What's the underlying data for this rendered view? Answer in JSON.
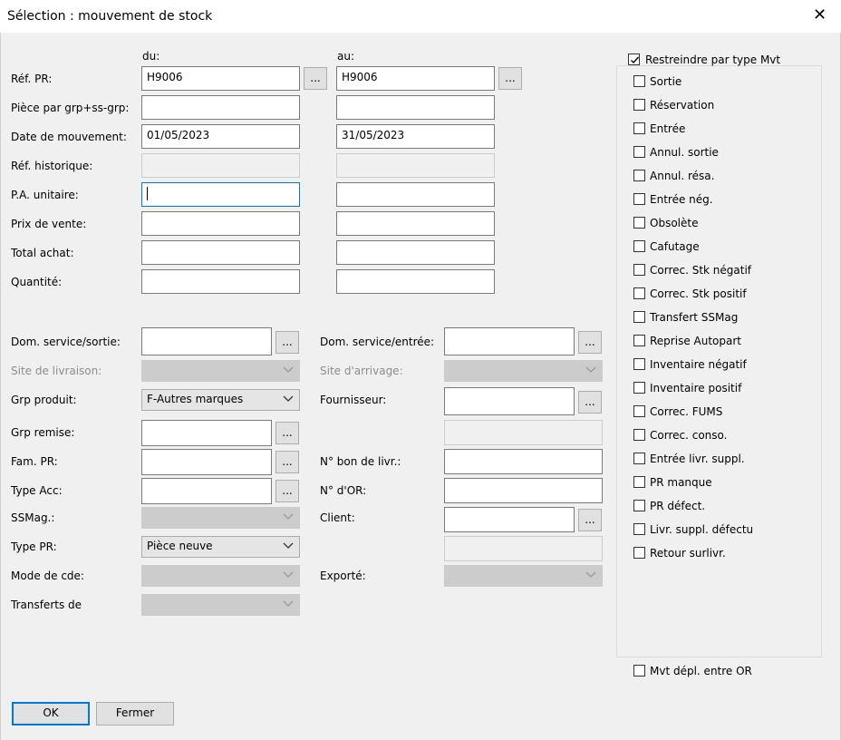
{
  "window": {
    "title": "Sélection : mouvement de stock",
    "close_glyph": "✕"
  },
  "columns": {
    "from": "du:",
    "to": "au:"
  },
  "ellipsis": "...",
  "rows": {
    "ref_pr": {
      "label": "Réf. PR:",
      "from": "H9006",
      "to": "H9006"
    },
    "piece_grp": {
      "label": "Pièce par grp+ss-grp:",
      "from": "",
      "to": ""
    },
    "date_mvt": {
      "label": "Date de mouvement:",
      "from": "01/05/2023",
      "to": "31/05/2023"
    },
    "ref_hist": {
      "label": "Réf. historique:",
      "from": "",
      "to": ""
    },
    "pa_unit": {
      "label": "P.A. unitaire:",
      "from": "",
      "to": ""
    },
    "prix_vente": {
      "label": "Prix de vente:",
      "from": "",
      "to": ""
    },
    "total_achat": {
      "label": "Total achat:",
      "from": "",
      "to": ""
    },
    "quantite": {
      "label": "Quantité:",
      "from": "",
      "to": ""
    }
  },
  "left_fields": {
    "dom_sortie": {
      "label": "Dom. service/sortie:",
      "value": ""
    },
    "site_livraison": {
      "label": "Site de livraison:",
      "value": ""
    },
    "grp_produit": {
      "label": "Grp produit:",
      "value": "F-Autres marques"
    },
    "grp_remise": {
      "label": "Grp remise:",
      "value": ""
    },
    "fam_pr": {
      "label": "Fam. PR:",
      "value": ""
    },
    "type_acc": {
      "label": "Type Acc:",
      "value": ""
    },
    "ssmag": {
      "label": "SSMag.:",
      "value": ""
    },
    "type_pr": {
      "label": "Type PR:",
      "value": "Pièce neuve"
    },
    "mode_cde": {
      "label": "Mode de cde:",
      "value": ""
    },
    "transferts": {
      "label": "Transferts de",
      "value": ""
    }
  },
  "right_fields": {
    "dom_entree": {
      "label": "Dom. service/entrée:",
      "value": ""
    },
    "site_arrivage": {
      "label": "Site d'arrivage:",
      "value": ""
    },
    "fournisseur": {
      "label": "Fournisseur:",
      "value": "",
      "extra": ""
    },
    "bon_livr": {
      "label": "N° bon de livr.:",
      "value": ""
    },
    "num_or": {
      "label": "N° d'OR:",
      "value": ""
    },
    "client": {
      "label": "Client:",
      "value": "",
      "extra": ""
    },
    "exporte": {
      "label": "Exporté:",
      "value": ""
    }
  },
  "mvt_types": {
    "restrict_label": "Restreindre par type Mvt",
    "restrict_checked": true,
    "items": [
      {
        "label": "Sortie",
        "checked": false
      },
      {
        "label": "Réservation",
        "checked": false
      },
      {
        "label": "Entrée",
        "checked": false
      },
      {
        "label": "Annul. sortie",
        "checked": false
      },
      {
        "label": "Annul. résa.",
        "checked": false
      },
      {
        "label": "Entrée nég.",
        "checked": false
      },
      {
        "label": "Obsolète",
        "checked": false
      },
      {
        "label": "Cafutage",
        "checked": false
      },
      {
        "label": "Correc. Stk négatif",
        "checked": false
      },
      {
        "label": "Correc. Stk positif",
        "checked": false
      },
      {
        "label": "Transfert SSMag",
        "checked": false
      },
      {
        "label": "Reprise Autopart",
        "checked": false
      },
      {
        "label": "Inventaire négatif",
        "checked": false
      },
      {
        "label": "Inventaire positif",
        "checked": false
      },
      {
        "label": "Correc. FUMS",
        "checked": false
      },
      {
        "label": "Correc. conso.",
        "checked": false
      },
      {
        "label": "Entrée livr. suppl.",
        "checked": false
      },
      {
        "label": "PR manque",
        "checked": false
      },
      {
        "label": "PR défect.",
        "checked": false
      },
      {
        "label": "Livr. suppl. défectu",
        "checked": false
      },
      {
        "label": "Retour surlivr.",
        "checked": false
      }
    ]
  },
  "mvt_depl": {
    "label": "Mvt dépl. entre OR",
    "checked": false
  },
  "buttons": {
    "ok": "OK",
    "close": "Fermer"
  },
  "colors": {
    "focus_border": "#0078d7",
    "window_bg": "#f0f0f0"
  }
}
